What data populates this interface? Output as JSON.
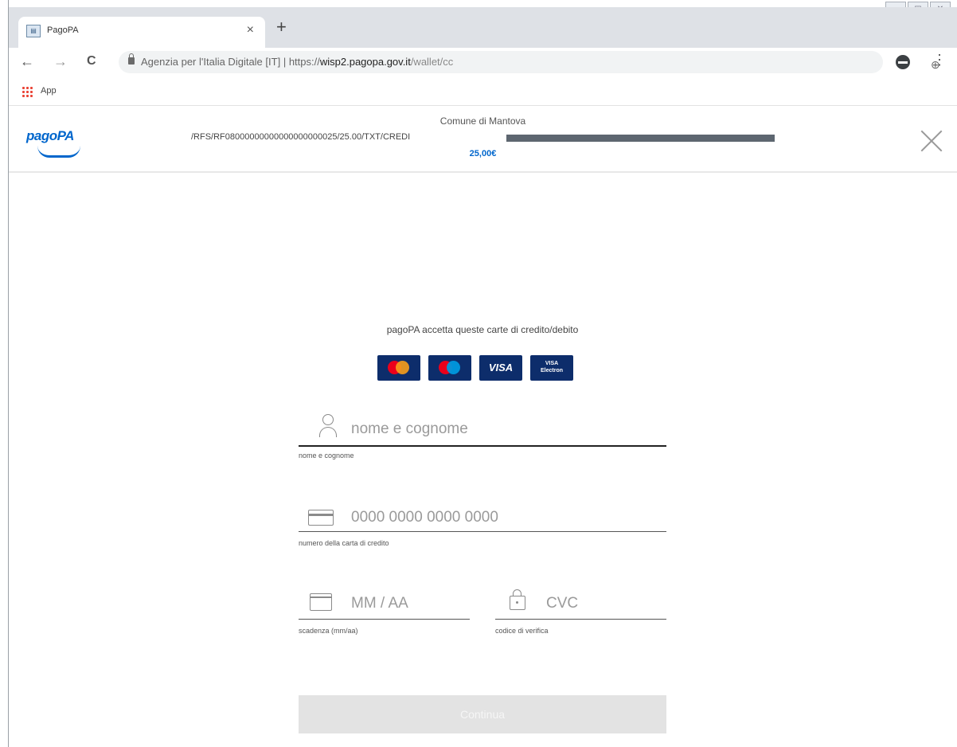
{
  "browser": {
    "tab_title": "PagoPA",
    "tab_close": "×",
    "new_tab": "+",
    "back": "←",
    "forward": "→",
    "reload": "C",
    "site_identity": "Agenzia per l'Italia Digitale [IT]",
    "separator": "|",
    "url_scheme": "https://",
    "url_host": "wisp2.pagopa.gov.it",
    "url_path": "/wallet/cc",
    "zoom_icon": "⊕",
    "star_icon": "☆",
    "menu_icon": "⋮",
    "bookmarks_apps_label": "App"
  },
  "header": {
    "logo": "pagoPA",
    "merchant": "Comune di Mantova",
    "reference": "/RFS/RF08000000000000000000025/25.00/TXT/CREDI",
    "amount": "25,00€"
  },
  "form": {
    "accept_text": "pagoPA accetta queste carte di credito/debito",
    "cards": [
      {
        "name": "mastercard"
      },
      {
        "name": "maestro"
      },
      {
        "name": "visa",
        "label": "VISA"
      },
      {
        "name": "visa-electron",
        "label_top": "VISA",
        "label_bottom": "Electron"
      }
    ],
    "name_field": {
      "placeholder": "nome e cognome",
      "value": "",
      "helper": "nome e cognome"
    },
    "card_number_field": {
      "placeholder": "0000 0000 0000 0000",
      "value": "",
      "helper": "numero della carta di credito"
    },
    "expiry_field": {
      "placeholder": "MM / AA",
      "value": "",
      "helper": "scadenza (mm/aa)"
    },
    "cvc_field": {
      "placeholder": "CVC",
      "value": "",
      "helper": "codice di verifica"
    },
    "continue_label": "Continua"
  },
  "colors": {
    "brand_blue": "#0066cc",
    "button_disabled": "#e3e3e3"
  }
}
